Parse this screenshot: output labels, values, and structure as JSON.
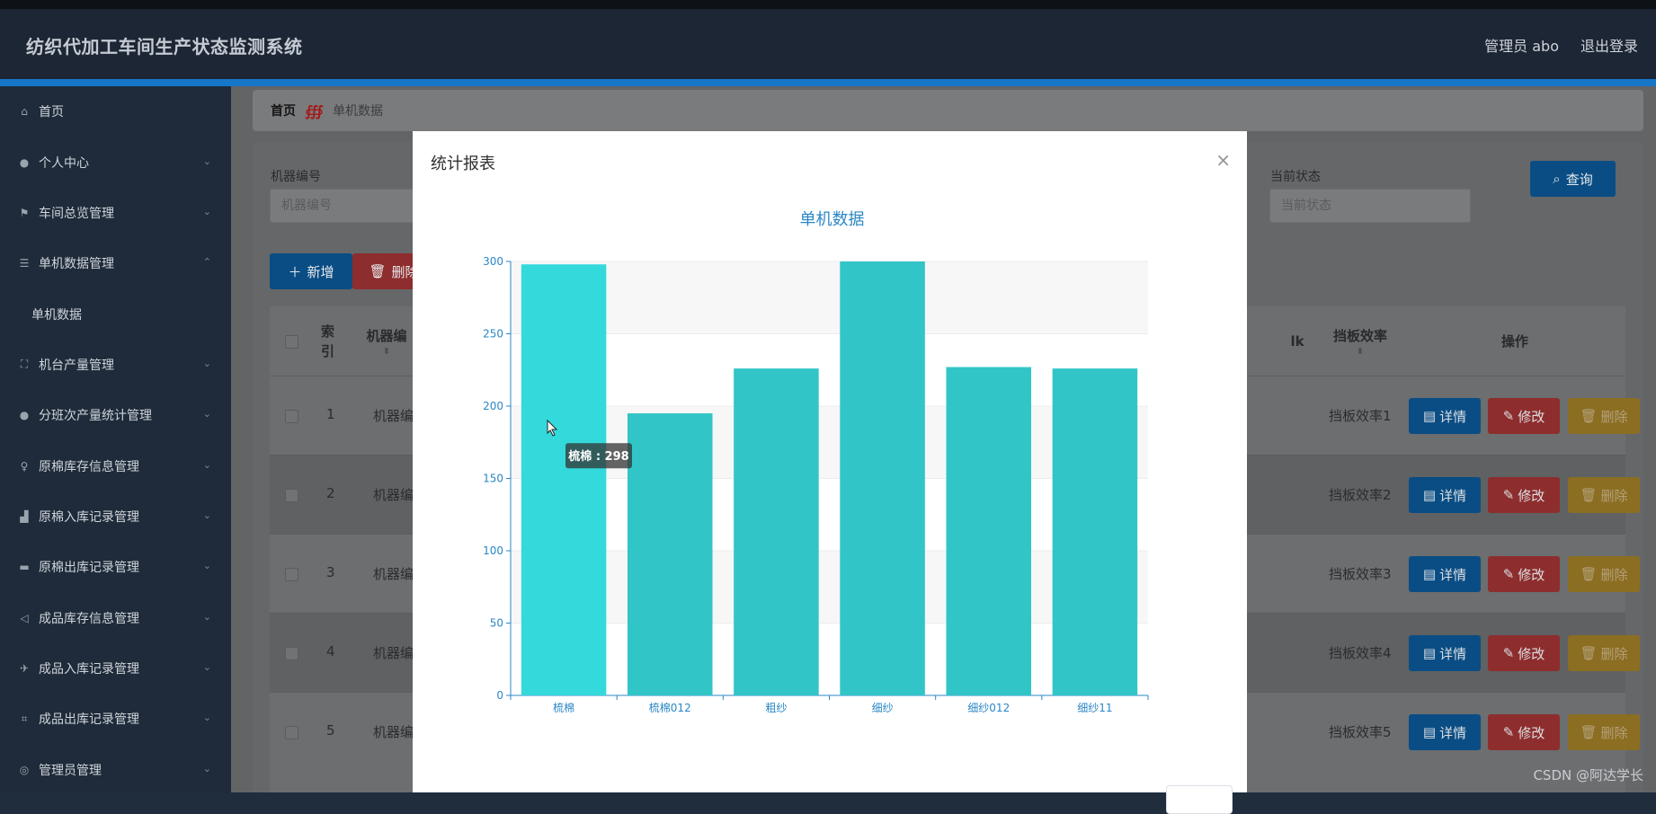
{
  "app": {
    "title": "纺织代加工车间生产状态监测系统",
    "admin": "管理员 abo",
    "logout": "退出登录"
  },
  "sidebar": {
    "items": [
      {
        "label": "首页",
        "icon": "home-icon",
        "glyph": "⌂"
      },
      {
        "label": "个人中心",
        "icon": "user-icon",
        "glyph": "●"
      },
      {
        "label": "车间总览管理",
        "icon": "flag-icon",
        "glyph": "⚑"
      },
      {
        "label": "单机数据管理",
        "icon": "list-icon",
        "glyph": "☰"
      },
      {
        "label": "机台产量管理",
        "icon": "frame-icon",
        "glyph": "⛶"
      },
      {
        "label": "分班次产量统计管理",
        "icon": "user-icon",
        "glyph": "●"
      },
      {
        "label": "原棉库存信息管理",
        "icon": "bulb-icon",
        "glyph": "♀"
      },
      {
        "label": "原棉入库记录管理",
        "icon": "shop-icon",
        "glyph": "▟"
      },
      {
        "label": "原棉出库记录管理",
        "icon": "chat-icon",
        "glyph": "▬"
      },
      {
        "label": "成品库存信息管理",
        "icon": "send-icon",
        "glyph": "◁"
      },
      {
        "label": "成品入库记录管理",
        "icon": "plane-icon",
        "glyph": "✈"
      },
      {
        "label": "成品出库记录管理",
        "icon": "crop-icon",
        "glyph": "⌗"
      },
      {
        "label": "管理员管理",
        "icon": "compass-icon",
        "glyph": "◎"
      }
    ],
    "sub": "单机数据"
  },
  "breadcrumb": {
    "home": "首页",
    "sep": "∰",
    "current": "单机数据"
  },
  "search": {
    "machine_label": "机器编号",
    "machine_placeholder": "机器编号",
    "state_label": "当前状态",
    "state_placeholder": "当前状态",
    "query": "查询"
  },
  "toolbar": {
    "add": "新增",
    "delete": "删除"
  },
  "table": {
    "headers": {
      "index": "索引",
      "machine": "机器编",
      "extra": "lk",
      "efficiency": "挡板效率",
      "ops": "操作"
    },
    "rows": [
      {
        "index": "1",
        "machine": "机器编",
        "efficiency": "挡板效率1"
      },
      {
        "index": "2",
        "machine": "机器编",
        "efficiency": "挡板效率2"
      },
      {
        "index": "3",
        "machine": "机器编",
        "efficiency": "挡板效率3"
      },
      {
        "index": "4",
        "machine": "机器编",
        "efficiency": "挡板效率4"
      },
      {
        "index": "5",
        "machine": "机器编",
        "efficiency": "挡板效率5"
      }
    ],
    "row_buttons": {
      "detail": "详情",
      "edit": "修改",
      "delete": "删除"
    }
  },
  "modal": {
    "title": "统计报表",
    "close": "×"
  },
  "chart_data": {
    "type": "bar",
    "title": "单机数据",
    "categories": [
      "梳棉",
      "梳棉012",
      "粗纱",
      "细纱",
      "细纱012",
      "细纱11"
    ],
    "values": [
      298,
      195,
      226,
      300,
      227,
      226
    ],
    "ylim": [
      0,
      300
    ],
    "yticks": [
      0,
      50,
      100,
      150,
      200,
      250,
      300
    ],
    "xlabel": "",
    "ylabel": "",
    "bar_color": "#32c5c8",
    "highlight_color": "#34d9dc",
    "title_color": "#2b87c5",
    "axis_color": "#2b87c5",
    "tooltip": "梳棉 : 298"
  },
  "watermark": "CSDN @阿达学长"
}
